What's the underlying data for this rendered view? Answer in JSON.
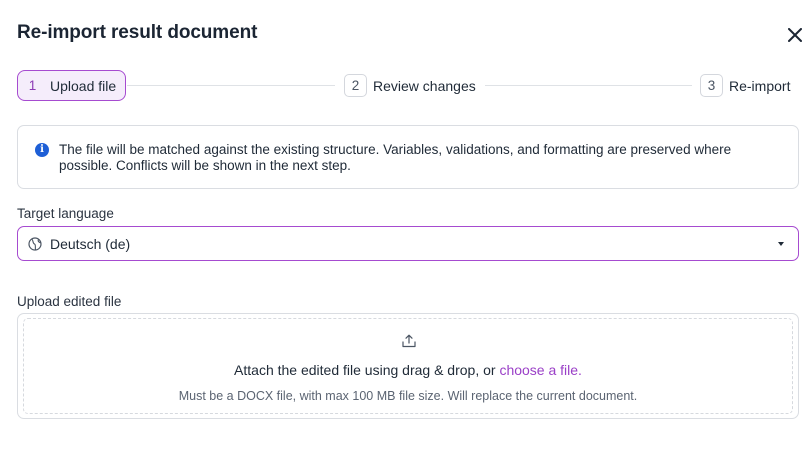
{
  "dialog": {
    "title": "Re-import result document"
  },
  "stepper": {
    "steps": [
      {
        "number": "1",
        "label": "Upload file",
        "active": true
      },
      {
        "number": "2",
        "label": "Review changes",
        "active": false
      },
      {
        "number": "3",
        "label": "Re-import",
        "active": false
      }
    ]
  },
  "info": {
    "icon": "info-icon",
    "text": "The file will be matched against the existing structure. Variables, validations, and formatting are preserved where possible. Conflicts will be shown in the next step."
  },
  "target_language": {
    "label": "Target language",
    "value": "Deutsch (de)",
    "icon": "globe-icon"
  },
  "upload": {
    "label": "Upload edited file",
    "prompt": "Attach the edited file using drag & drop, or",
    "link": "choose a file.",
    "hint": "Must be a DOCX file, with max 100 MB file size. Will replace the current document.",
    "icon": "upload-icon"
  },
  "colors": {
    "accent": "#a64bd0",
    "link": "#9a3fc7",
    "info_icon": "#1e5fd6"
  }
}
